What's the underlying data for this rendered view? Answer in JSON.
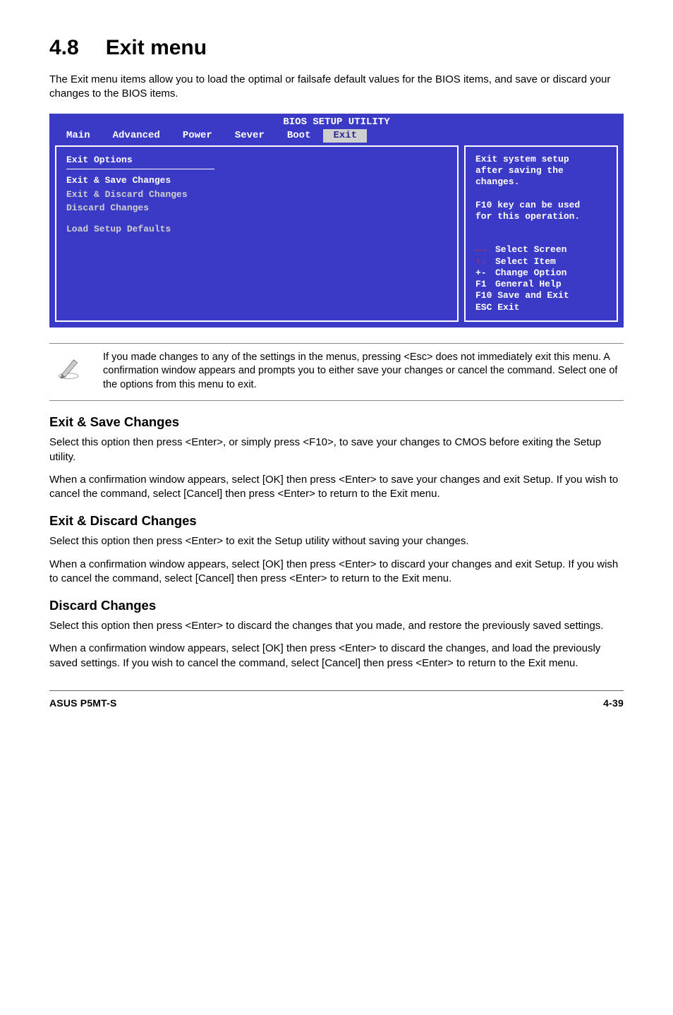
{
  "section": {
    "number": "4.8",
    "title": "Exit menu",
    "intro": "The Exit menu items allow you to load the optimal or failsafe default values for the BIOS items, and save or discard your changes to the BIOS items."
  },
  "bios": {
    "title": "BIOS SETUP UTILITY",
    "tabs": [
      "Main",
      "Advanced",
      "Power",
      "Sever",
      "Boot",
      "Exit"
    ],
    "activeTab": "Exit",
    "left": {
      "group": "Exit Options",
      "items": [
        "Exit & Save Changes",
        "Exit & Discard Changes",
        "Discard Changes"
      ],
      "extra": "Load Setup Defaults"
    },
    "right": {
      "help": [
        "Exit system setup",
        "after saving the",
        "changes.",
        "",
        "F10 key can be used",
        "for this operation."
      ],
      "keys": [
        {
          "sym": "←→",
          "label": "Select Screen",
          "symColored": true
        },
        {
          "sym": "↑↓",
          "label": "Select Item",
          "symColored": true
        },
        {
          "sym": "+-",
          "label": "Change Option",
          "symColored": false
        },
        {
          "sym": "F1",
          "label": "General Help",
          "symColored": false
        },
        {
          "sym": "F10",
          "label": "Save and Exit",
          "symColored": false,
          "noGap": true
        },
        {
          "sym": "ESC",
          "label": "Exit",
          "symColored": false,
          "noGap": true
        }
      ]
    }
  },
  "note": {
    "text": "If you made changes to any of the settings in the menus, pressing <Esc> does not immediately exit this menu. A confirmation window appears and prompts you to either save your changes or cancel the command. Select one of the options from this menu to exit."
  },
  "subsections": [
    {
      "heading": "Exit & Save Changes",
      "paragraphs": [
        "Select this option then press <Enter>, or simply press <F10>, to save your changes to CMOS before exiting the Setup utility.",
        "When a confirmation window appears, select [OK] then press <Enter> to save your changes and exit Setup. If you wish to cancel the command, select [Cancel] then press <Enter> to return to the Exit menu."
      ]
    },
    {
      "heading": "Exit & Discard Changes",
      "paragraphs": [
        "Select this option then press <Enter> to exit the Setup utility without saving your changes.",
        "When a confirmation window appears, select [OK] then press <Enter> to discard your changes and exit Setup. If you wish to cancel the command, select [Cancel] then press <Enter> to return to the Exit menu."
      ]
    },
    {
      "heading": "Discard Changes",
      "paragraphs": [
        "Select this option then press <Enter> to discard the changes that you made, and restore the previously saved settings.",
        "When a confirmation window appears, select [OK] then press <Enter> to discard the changes, and load the previously saved settings. If you wish to cancel the command, select [Cancel] then press <Enter> to return to the Exit menu."
      ]
    }
  ],
  "footer": {
    "left": "ASUS P5MT-S",
    "right": "4-39"
  }
}
